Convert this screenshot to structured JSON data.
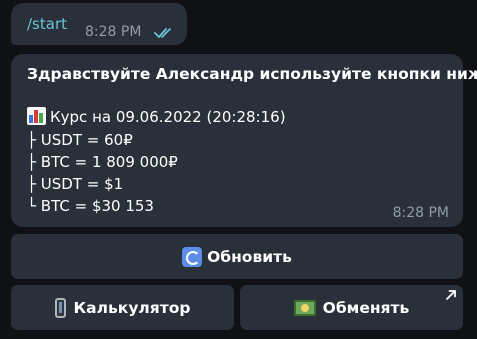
{
  "outgoing_message": {
    "text": "/start",
    "time": "8:28 PM",
    "status_icon": "double-check-icon",
    "text_color": "#68c2d8"
  },
  "incoming_message": {
    "greeting": "Здравствуйте Александр используйте кнопки ниже",
    "rate_header_icon": "bar-chart-icon",
    "rate_header": "Курс на 09.06.2022 (20:28:16)",
    "rates": [
      "├ USDT = 60₽",
      "├ BTC = 1 809 000₽",
      "├ USDT = $1",
      "└ BTC = $30 153"
    ],
    "time": "8:28 PM"
  },
  "inline_keyboard": {
    "refresh": {
      "label": "Обновить",
      "icon": "refresh-icon"
    },
    "calculator": {
      "label": "Калькулятор",
      "icon": "mobile-phone-icon"
    },
    "exchange": {
      "label": "Обменять",
      "icon": "money-bill-icon",
      "badge_icon": "link-arrow-icon"
    }
  },
  "colors": {
    "background": "#0f1115",
    "bubble": "#2a3039",
    "secondary_text": "#8f9ba6"
  }
}
